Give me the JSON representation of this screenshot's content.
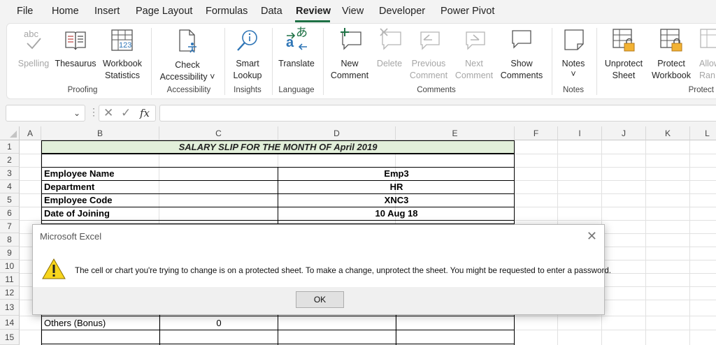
{
  "menu": {
    "tabs": [
      "File",
      "Home",
      "Insert",
      "Page Layout",
      "Formulas",
      "Data",
      "Review",
      "View",
      "Developer",
      "Power Pivot"
    ],
    "active_tab": "Review"
  },
  "ribbon": {
    "groups": {
      "proofing": "Proofing",
      "accessibility": "Accessibility",
      "insights": "Insights",
      "language": "Language",
      "comments": "Comments",
      "notes": "Notes",
      "protect": "Protect"
    },
    "buttons": {
      "spelling": "Spelling",
      "thesaurus": "Thesaurus",
      "workbook_statistics_1": "Workbook",
      "workbook_statistics_2": "Statistics",
      "check_accessibility_1": "Check",
      "check_accessibility_2": "Accessibility ˅",
      "smart_lookup_1": "Smart",
      "smart_lookup_2": "Lookup",
      "translate": "Translate",
      "new_comment_1": "New",
      "new_comment_2": "Comment",
      "delete": "Delete",
      "previous_comment_1": "Previous",
      "previous_comment_2": "Comment",
      "next_comment_1": "Next",
      "next_comment_2": "Comment",
      "show_comments_1": "Show",
      "show_comments_2": "Comments",
      "notes_1": "Notes",
      "notes_2": "˅",
      "unprotect_sheet_1": "Unprotect",
      "unprotect_sheet_2": "Sheet",
      "protect_workbook_1": "Protect",
      "protect_workbook_2": "Workbook",
      "allow_ranges_1": "Allow",
      "allow_ranges_2": "Ran"
    },
    "icon_texts": {
      "abc": "abc",
      "a": "a",
      "a_jp": "あ",
      "n123": "123"
    }
  },
  "formula_bar": {
    "name_box": "",
    "fx": "fx",
    "value": ""
  },
  "sheet": {
    "columns": [
      "A",
      "B",
      "C",
      "D",
      "E",
      "F",
      "I",
      "J",
      "K",
      "L"
    ],
    "rows": [
      "1",
      "2",
      "3",
      "4",
      "5",
      "6",
      "7",
      "8",
      "9",
      "10",
      "11",
      "12",
      "13",
      "14",
      "15"
    ],
    "title": "SALARY SLIP FOR THE MONTH OF April 2019",
    "employee": [
      {
        "label": "Employee Name",
        "value": "Emp3"
      },
      {
        "label": "Department",
        "value": "HR"
      },
      {
        "label": "Employee Code",
        "value": "XNC3"
      },
      {
        "label": "Date of Joining",
        "value": "10 Aug 18"
      }
    ],
    "row14": {
      "label": "Others (Bonus)",
      "value": "0"
    }
  },
  "dialog": {
    "title": "Microsoft Excel",
    "message": "The cell or chart you're trying to change is on a protected sheet. To make a change, unprotect the sheet. You might be requested to enter a password.",
    "ok_label": "OK",
    "close_icon": "close-icon",
    "warning_icon": "warning-icon"
  },
  "colors": {
    "accent": "#1e7145",
    "title_fill": "#e2efda",
    "warning_fill": "#f7d51d"
  }
}
